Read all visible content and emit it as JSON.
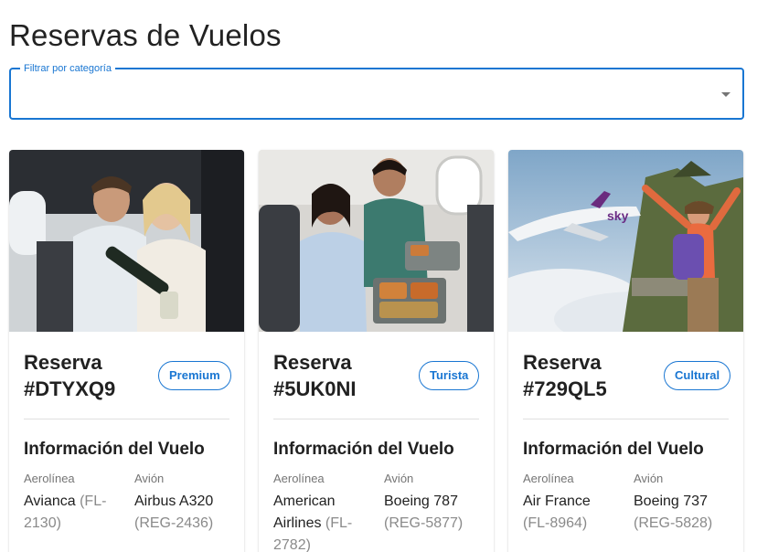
{
  "page": {
    "title": "Reservas de Vuelos"
  },
  "filter": {
    "label": "Filtrar por categoría",
    "value": ""
  },
  "colors": {
    "primary": "#1976d2"
  },
  "cards": [
    {
      "reserva_label": "Reserva",
      "code": "#DTYXQ9",
      "category": "Premium",
      "image_desc": "couple-champagne-cabin",
      "section_title": "Información del Vuelo",
      "airline_label": "Aerolínea",
      "airline": "Avianca",
      "flight": "(FL-2130)",
      "aircraft_label": "Avión",
      "aircraft": "Airbus A320",
      "registration": "(REG-2436)"
    },
    {
      "reserva_label": "Reserva",
      "code": "#5UK0NI",
      "category": "Turista",
      "image_desc": "couple-meal-cabin",
      "section_title": "Información del Vuelo",
      "airline_label": "Aerolínea",
      "airline": "American Airlines",
      "flight": "(FL-2782)",
      "aircraft_label": "Avión",
      "aircraft": "Boeing 787",
      "registration": "(REG-5877)"
    },
    {
      "reserva_label": "Reserva",
      "code": "#729QL5",
      "category": "Cultural",
      "image_desc": "plane-machu-picchu",
      "section_title": "Información del Vuelo",
      "airline_label": "Aerolínea",
      "airline": "Air France",
      "flight": "(FL-8964)",
      "aircraft_label": "Avión",
      "aircraft": "Boeing 737",
      "registration": "(REG-5828)"
    }
  ]
}
